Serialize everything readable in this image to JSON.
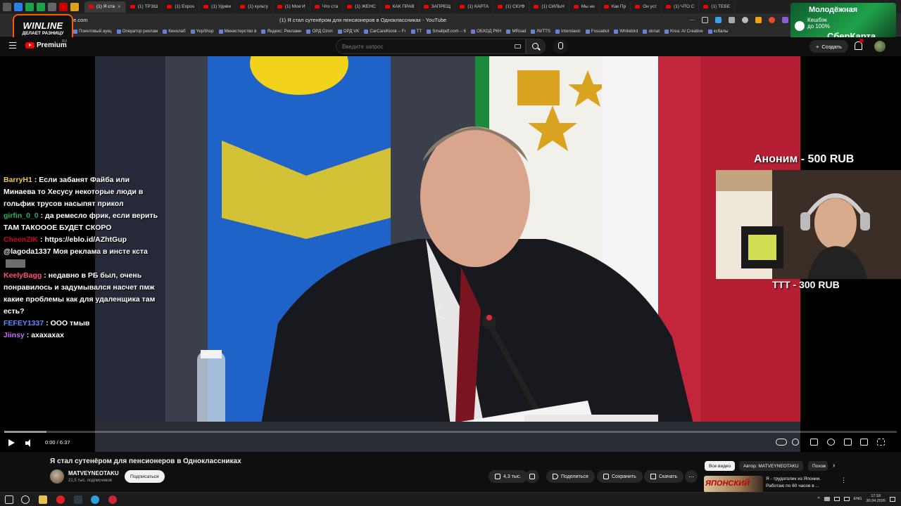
{
  "browser": {
    "tabs": [
      {
        "label": "(1) Я ста",
        "active": true
      },
      {
        "label": "(1) ТРЭШ"
      },
      {
        "label": "(1) Expos"
      },
      {
        "label": "(1) Удиви"
      },
      {
        "label": "(1) культу"
      },
      {
        "label": "(1) Моя И"
      },
      {
        "label": "Что ста"
      },
      {
        "label": "(1) ЖЕНС"
      },
      {
        "label": "КАК ПРАВ"
      },
      {
        "label": "ЗАПРЕЩ"
      },
      {
        "label": "(1) КАРТА"
      },
      {
        "label": "(1) СКУФ"
      },
      {
        "label": "(1) СИЛЬН"
      },
      {
        "label": "Мы не"
      },
      {
        "label": "Как Пр"
      },
      {
        "label": "Он уст"
      },
      {
        "label": "(1) ЧТО С"
      },
      {
        "label": "(1) ТЕБЕ"
      }
    ],
    "url_fragment": "be.com",
    "page_title": "(1) Я стал сутенёром для пенсионеров в Одноклассниках - YouTube",
    "bookmarks": [
      "Поинтовый аукц",
      "Оператор реклам",
      "Кинолаб",
      "YepShop",
      "Министерство в",
      "Яндекс: Рекламн",
      "ОРД Ozon",
      "ОРД VK",
      "CarCareKiosk – Fr",
      "TT",
      "Smallpdf.com – 6",
      "ОБХОД РКН",
      "MRoad",
      "/N/TTS",
      "Interslavic",
      "Fossabot",
      "Whitebird",
      "donat",
      "Krea: AI Creative",
      "ксбалы"
    ]
  },
  "overlays": {
    "winline": {
      "brand": "WINLINE",
      "tagline": "ДЕЛАЕТ РАЗНИЦУ"
    },
    "sber_ad": {
      "line1": "Молодёжная",
      "line2": "Кешбэк",
      "line3": "до 100%",
      "line4": "СберКарта"
    },
    "donations": {
      "top": "Аноним - 500 RUB",
      "bottom": "ТТТ - 300 RUB"
    },
    "chat": [
      {
        "user": "BarryH1",
        "color": "#f2c94c",
        "text": "Если забанят Файба или Минаева то Хесусу некоторые люди в гольфик трусов насыпят прикол"
      },
      {
        "user": "girfin_0_0",
        "color": "#27ae60",
        "text": "да ремесло фрик, если верить ТАМ ТАКОООЕ БУДЕТ СКОРО"
      },
      {
        "user": "CheenZIK",
        "color": "#d0021b",
        "text": "https://eblo.id/AZhtGup @lagoda1337 Моя реклама в инсте кста",
        "emote": true
      },
      {
        "user": "KeelyBagg",
        "color": "#ff4f7a",
        "text": "недавно в РБ был, очень понравилось и задумывался насчет пмж какие проблемы как для удаленщика там есть?"
      },
      {
        "user": "FEFEY1337",
        "color": "#5b8cff",
        "text": "ООО тмыв"
      },
      {
        "user": "Jiinsy",
        "color": "#c86bff",
        "text": "ахахахах"
      }
    ]
  },
  "youtube": {
    "premium_label": "Premium",
    "region": "RU",
    "search_placeholder": "Введите запрос",
    "create_label": "Создать",
    "player": {
      "time": "0:00 / 6:37",
      "loaded_fraction": 0.047
    },
    "video_title": "Я стал сутенёром для пенсионеров в Одноклассниках",
    "channel": {
      "name": "MATVEYNEOTAKU",
      "subs": "21,5 тыс. подписчиков",
      "subscribe_label": "Подписаться"
    },
    "actions": {
      "likes": "4,3 тыс.",
      "share": "Поделиться",
      "save": "Сохранить",
      "download": "Скачать",
      "more": "..."
    },
    "chips": [
      "Все видео",
      "Автор: MATVEYNEOTAKU",
      "Похож"
    ],
    "recommendation": {
      "thumb_text": "ЯПОНСКИЙ",
      "title": "Я - трудоголик из Японии. Работаю по 60 часов в ..."
    }
  },
  "taskbar": {
    "lang": "ENG",
    "time": "17:18",
    "date": "30.04.2026"
  },
  "colors": {
    "accent_red": "#ff0000",
    "winline_orange": "#ff5a00",
    "sber_green": "#1fa24a"
  }
}
